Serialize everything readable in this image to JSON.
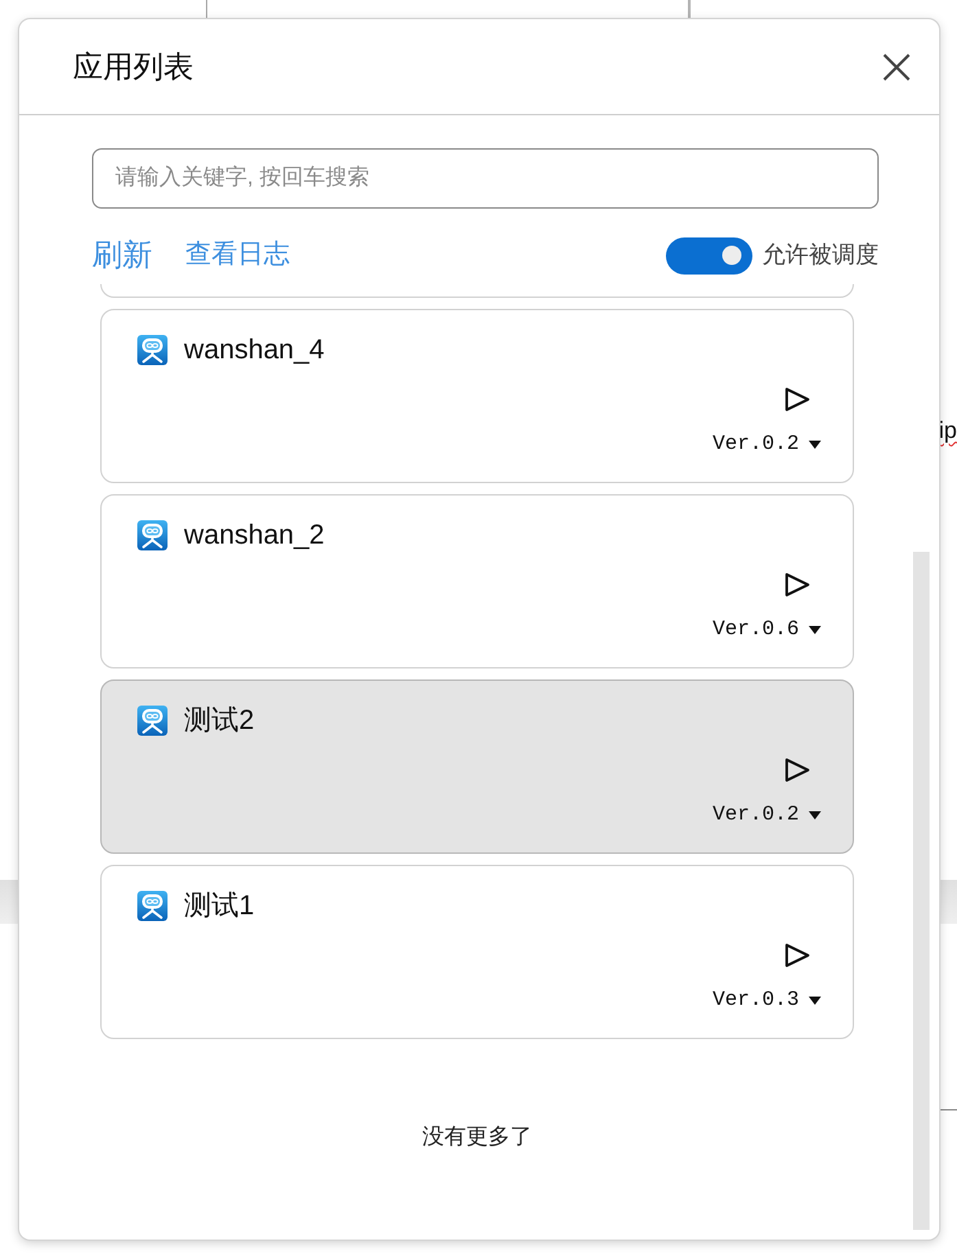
{
  "dialog": {
    "title": "应用列表"
  },
  "search": {
    "placeholder": "请输入关键字, 按回车搜索"
  },
  "toolbar": {
    "links": [
      {
        "label": "刷新",
        "kind": "primary"
      },
      {
        "label": "查看日志",
        "kind": "secondary"
      }
    ],
    "toggle": {
      "label": "允许被调度",
      "on": true
    }
  },
  "apps": [
    {
      "name": "wanshan_4",
      "version": "Ver.0.2",
      "selected": false
    },
    {
      "name": "wanshan_2",
      "version": "Ver.0.6",
      "selected": false
    },
    {
      "name": "测试2",
      "version": "Ver.0.2",
      "selected": true
    },
    {
      "name": "测试1",
      "version": "Ver.0.3",
      "selected": false
    }
  ],
  "list_end": "没有更多了",
  "background": {
    "text": "ip"
  }
}
